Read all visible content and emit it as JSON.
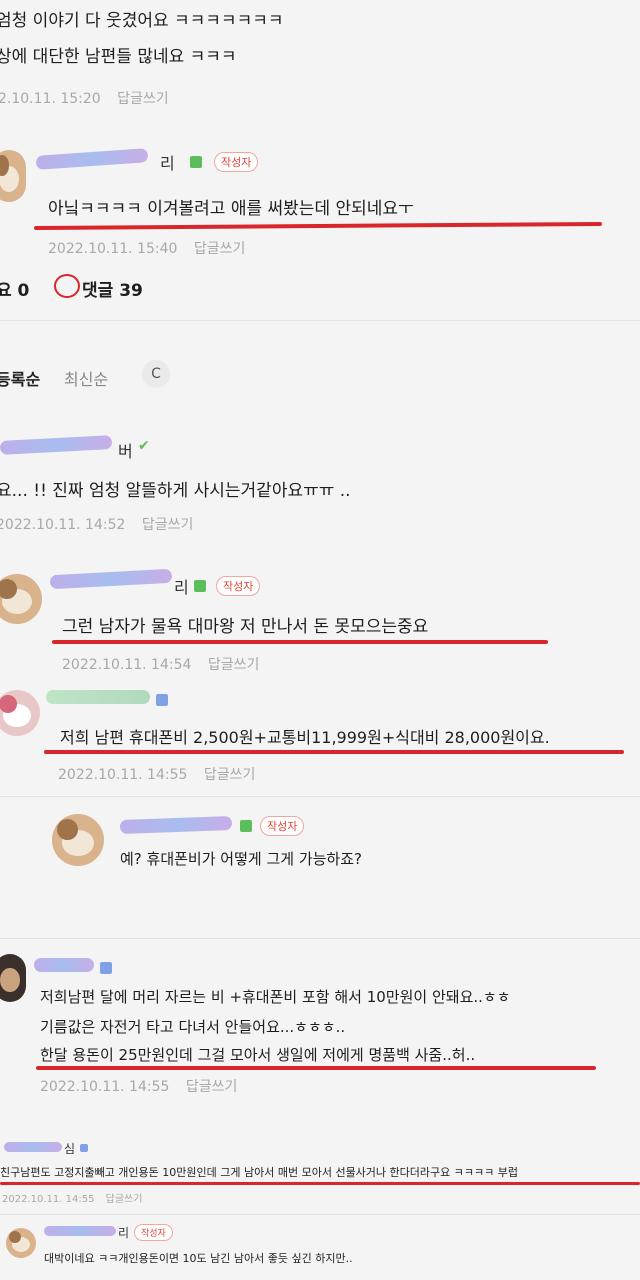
{
  "top": {
    "line1": "엄청 이야기 다 웃겼어요 ㅋㅋㅋㅋㅋㅋㅋ",
    "line2": "상에 대단한 남편들 많네요 ㅋㅋㅋ",
    "date": "2.10.11. 15:20",
    "reply": "답글쓰기"
  },
  "c1": {
    "nick_visible": "리",
    "badge": "작성자",
    "text": "아닠ㅋㅋㅋㅋ 이겨볼려고 애를 써봤는데 안되네요ㅜ",
    "date": "2022.10.11. 15:40",
    "reply": "답글쓰기"
  },
  "stats": {
    "like_label": "요 0",
    "comment_label": "댓글 39"
  },
  "sort": {
    "order1": "등록순",
    "order2": "최신순",
    "refresh": "C"
  },
  "c2": {
    "nick_visible": "버",
    "text": "요... !! 진짜 엄청 알뜰하게 사시는거같아요ㅠㅠ ..",
    "date": "2022.10.11. 14:52",
    "reply": "답글쓰기"
  },
  "c3": {
    "nick_visible": "리",
    "badge": "작성자",
    "text": "그런 남자가 물욕 대마왕 저 만나서 돈 못모으는중요",
    "date": "2022.10.11. 14:54",
    "reply": "답글쓰기"
  },
  "c4": {
    "text": "저희 남편 휴대폰비 2,500원+교통비11,999원+식대비 28,000원이요.",
    "date": "2022.10.11. 14:55",
    "reply": "답글쓰기"
  },
  "c5": {
    "badge": "작성자",
    "text": "예? 휴대폰비가 어떻게 그게 가능하죠?"
  },
  "c6": {
    "line1": "저희남편 달에 머리 자르는 비 +휴대폰비 포함 해서 10만원이 안돼요..ㅎㅎ",
    "line2": "기름값은 자전거 타고 다녀서 안들어요...ㅎㅎㅎ..",
    "line3": "한달 용돈이 25만원인데 그걸 모아서 생일에 저에게 명품백 사줌..허..",
    "date": "2022.10.11. 14:55",
    "reply": "답글쓰기"
  },
  "c7": {
    "nick_visible": "심",
    "text": "친구남편도 고정지출빼고 개인용돈 10만원인데 그게 남아서 매번 모아서 선물사거나 한다더라구요 ㅋㅋㅋㅋ 부럽",
    "date": "2022.10.11. 14:55",
    "reply": "답글쓰기"
  },
  "c8": {
    "nick_visible": "리",
    "badge": "작성자",
    "text": "대박이네요 ㅋㅋ개인용돈이면 10도 남긴 남아서 좋듯 싶긴 하지만.."
  },
  "colors": {
    "underline": "#d9262b",
    "scribble": "#b8a7e8",
    "badge": "#e0453a"
  }
}
